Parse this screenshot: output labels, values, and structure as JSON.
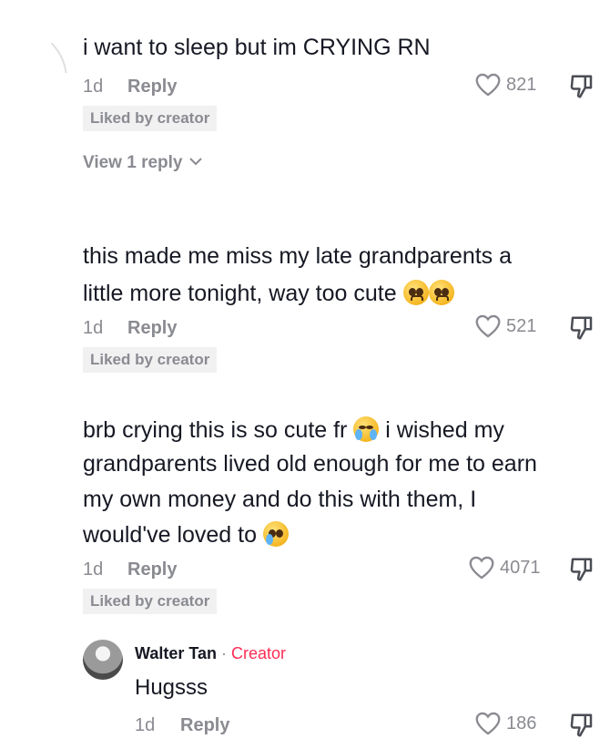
{
  "comments": [
    {
      "text": "i want to sleep but im CRYING RN",
      "time": "1d",
      "reply_label": "Reply",
      "likes": "821",
      "liked_badge": "Liked by creator",
      "view_replies": "View 1 reply"
    },
    {
      "text_line1": "this made me miss my late grandparents a",
      "text_line2": "little more tonight, way too cute",
      "emojis": [
        "pleading-face",
        "pleading-face"
      ],
      "time": "1d",
      "reply_label": "Reply",
      "likes": "521",
      "liked_badge": "Liked by creator"
    },
    {
      "text_line1a": "brb crying this is so cute fr",
      "text_line1b": "i wished my",
      "text_line2": "grandparents lived old enough for me to earn",
      "text_line3": "my own money and do this with them, I",
      "text_line4": "would've loved to",
      "emojis": [
        "loudly-crying-face",
        "crying-face"
      ],
      "time": "1d",
      "reply_label": "Reply",
      "likes": "4071",
      "liked_badge": "Liked by creator"
    }
  ],
  "reply": {
    "author": "Walter Tan",
    "separator": "·",
    "creator_tag": "Creator",
    "text": "Hugsss",
    "time": "1d",
    "reply_label": "Reply",
    "likes": "186"
  },
  "icons": {
    "like": "heart-outline-icon",
    "dislike": "thumbs-down-icon",
    "expand": "chevron-down-icon"
  },
  "colors": {
    "text": "#161823",
    "muted": "#8a8b91",
    "creator": "#fe2c55",
    "badge_bg": "#f1f1f2"
  }
}
